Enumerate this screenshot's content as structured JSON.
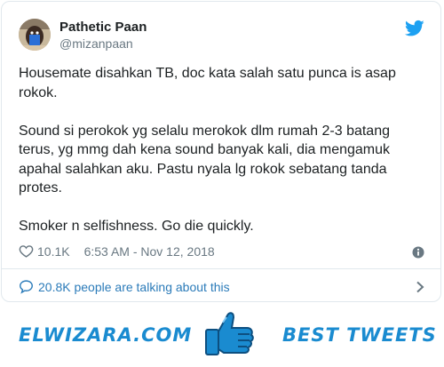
{
  "tweet": {
    "author_name": "Pathetic Paan",
    "author_handle": "@mizanpaan",
    "paragraphs": [
      "Housemate disahkan TB, doc kata salah satu punca is asap rokok.",
      "Sound si perokok yg selalu merokok dlm rumah 2-3 batang terus, yg mmg dah kena sound banyak kali, dia mengamuk apahal salahkan aku. Pastu nyala lg rokok sebatang tanda protes.",
      "Smoker n selfishness. Go die quickly."
    ],
    "likes": "10.1K",
    "timestamp": "6:53 AM - Nov 12, 2018",
    "talking": "20.8K people are talking about this"
  },
  "banner": {
    "site": "ELWIZARA.COM",
    "tagline": "BEST TWEETS"
  },
  "icons": {
    "brand": "twitter-bird-icon",
    "like": "heart-icon",
    "info": "info-icon",
    "talk": "speech-bubble-icon",
    "more": "chevron-right-icon",
    "banner": "thumbs-up-icon"
  },
  "colors": {
    "twitter_blue": "#1da1f2",
    "link_blue": "#2b7bb9",
    "banner_blue": "#1a8bd0",
    "text": "#1c2022",
    "muted": "#697882"
  }
}
